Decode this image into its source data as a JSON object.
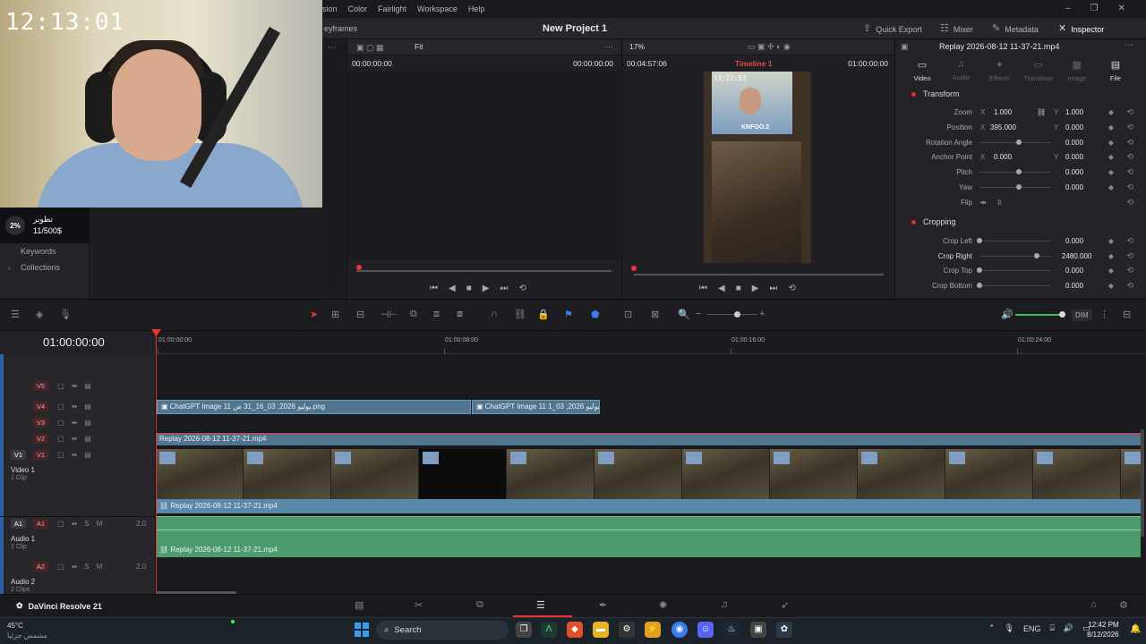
{
  "app": {
    "name": "DaVinci Resolve 21",
    "project": "New Project 1"
  },
  "stream": {
    "clock": "12:13:01",
    "donation_pct": "2%",
    "donation_title": "تطوير",
    "donation_amount": "11/500$"
  },
  "menu": [
    "sion",
    "Color",
    "Fairlight",
    "Workspace",
    "Help"
  ],
  "left_tab": "eyframes",
  "top_tools": {
    "quick_export": "Quick Export",
    "mixer": "Mixer",
    "metadata": "Metadata",
    "inspector": "Inspector"
  },
  "left_panel": {
    "items": [
      "Keywords",
      "Collections"
    ]
  },
  "source_viewer": {
    "fit": "Fit",
    "tc_left": "00:00:00:00",
    "tc_right": "00:00:00:00"
  },
  "program_viewer": {
    "zoom": "17%",
    "tc_left": "00:04:57:06",
    "timeline_name": "Timeline 1",
    "tc_right": "01:00:00:00",
    "preview_clock": "13:22:53",
    "preview_label": "KNFOO.2"
  },
  "inspector": {
    "clip_title": "Replay 2026-08-12 11-37-21.mp4",
    "tabs": [
      "Video",
      "Audio",
      "Effects",
      "Transition",
      "Image",
      "File"
    ],
    "transform_title": "Transform",
    "cropping_title": "Cropping",
    "rows": {
      "zoom": {
        "label": "Zoom",
        "x": "1.000",
        "y": "1.000"
      },
      "position": {
        "label": "Position",
        "x": "395.000",
        "y": "0.000"
      },
      "rotation": {
        "label": "Rotation Angle",
        "value": "0.000"
      },
      "anchor": {
        "label": "Anchor Point",
        "x": "0.000",
        "y": "0.000"
      },
      "pitch": {
        "label": "Pitch",
        "value": "0.000"
      },
      "yaw": {
        "label": "Yaw",
        "value": "0.000"
      },
      "flip": {
        "label": "Flip"
      },
      "crop_left": {
        "label": "Crop Left",
        "value": "0.000"
      },
      "crop_right": {
        "label": "Crop Right",
        "value": "2480.000"
      },
      "crop_top": {
        "label": "Crop Top",
        "value": "0.000"
      },
      "crop_bottom": {
        "label": "Crop Bottom",
        "value": "0.000"
      }
    },
    "axis_x": "X",
    "axis_y": "Y"
  },
  "timeline_toolbar": {
    "dim": "DIM"
  },
  "timeline": {
    "timecode": "01:00:00:00",
    "ruler": [
      "01:00:00:00",
      "01:00:08:00",
      "01:00:16:00",
      "01:00:24:00"
    ],
    "tracks": {
      "v5": "V5",
      "v4": "V4",
      "v3": "V3",
      "v2": "V2",
      "v1_src": "V1",
      "v1": "V1",
      "video1_name": "Video 1",
      "video1_clips": "1 Clip",
      "a1_src": "A1",
      "a1": "A1",
      "a1_level": "2.0",
      "audio1_name": "Audio 1",
      "audio1_clips": "1 Clip",
      "a2": "A2",
      "a2_level": "2.0",
      "audio2_name": "Audio 2",
      "audio2_clips": "2 Clips",
      "solo": "S",
      "mute": "M"
    },
    "clips": {
      "v4_clip1": "ChatGPT Image 11 يوليو 2026, 03_16_31 ص.png",
      "v4_clip2": "ChatGPT Image 11 يوليو 2026, 03_1...",
      "v2_clip": "Replay 2026-08-12 11-37-21.mp4",
      "v1_clip": "Replay 2026-08-12 11-37-21.mp4",
      "a1_clip": "Replay 2026-08-12 11-37-21.mp4"
    }
  },
  "taskbar": {
    "search": "Search",
    "lang": "ENG",
    "time": "12:42 PM",
    "date": "8/12/2026",
    "weather_temp": "45°C",
    "weather_desc": "مشمس جزئيا"
  },
  "colors": {
    "accent": "#e33333",
    "clip_blue": "#5a88a8",
    "audio_green": "#4c9b6c"
  }
}
